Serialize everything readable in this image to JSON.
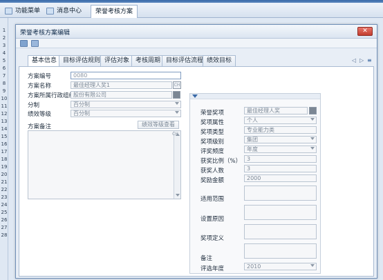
{
  "app_tabs": [
    {
      "label": "功能菜单"
    },
    {
      "label": "消息中心"
    },
    {
      "label": "荣誉考核方案"
    }
  ],
  "row_numbers": [
    "1",
    "2",
    "3",
    "4",
    "5",
    "6",
    "7",
    "8",
    "9",
    "10",
    "11",
    "12",
    "13",
    "14",
    "15",
    "16",
    "17",
    "18",
    "19",
    "20",
    "21",
    "22",
    "23",
    "24",
    "25",
    "26",
    "27",
    "28"
  ],
  "window": {
    "title": "荣誉考核方案编辑",
    "close_icon": "x-icon"
  },
  "form_tabs": [
    "基本信息",
    "目标评估规则",
    "评估对象",
    "考核周期",
    "目标评估流程",
    "绩效目标"
  ],
  "tab_nav": {
    "prev": "◁",
    "next": "▷",
    "menu": "≡"
  },
  "left": {
    "plan_no": {
      "label": "方案编号",
      "value": "0080"
    },
    "plan_name": {
      "label": "方案名称",
      "value": "最佳经理人奖1",
      "suffix": "CH"
    },
    "org": {
      "label": "方案所属行政组织",
      "value": "股份有限公司"
    },
    "category": {
      "label": "分制",
      "value": "百分制"
    },
    "grade": {
      "label": "绩效等级",
      "value": "百分制"
    },
    "remark": {
      "label": "方案备注",
      "suffix": "CH"
    },
    "grade_view_button": "绩效等级查看"
  },
  "right": {
    "honor_item": {
      "label": "荣誉奖项",
      "value": "最佳经理人奖"
    },
    "attr": {
      "label": "奖项属性",
      "value": "个人"
    },
    "type": {
      "label": "奖项类型",
      "value": "专业能力类"
    },
    "level": {
      "label": "奖项级别",
      "value": "集团"
    },
    "freq": {
      "label": "评奖频度",
      "value": "年度"
    },
    "ratio": {
      "label": "获奖比例（%）",
      "value": "3"
    },
    "count": {
      "label": "获奖人数",
      "value": "3"
    },
    "amount": {
      "label": "奖励金额",
      "value": "2000"
    },
    "scope": {
      "label": "适用范围"
    },
    "reason": {
      "label": "设置原因"
    },
    "definition": {
      "label": "奖项定义"
    },
    "note": {
      "label": "备注"
    },
    "year": {
      "label": "评选年度",
      "value": "2010"
    }
  }
}
